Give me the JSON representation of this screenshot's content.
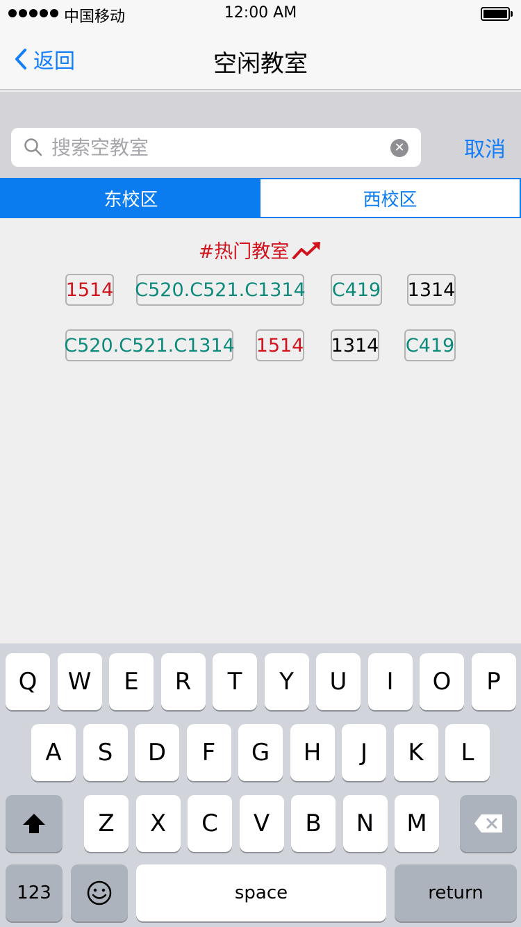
{
  "status_bar": {
    "carrier": "中国移动",
    "time": "12:00 AM"
  },
  "nav": {
    "back_label": "返回",
    "title": "空闲教室"
  },
  "search": {
    "placeholder": "搜索空教室",
    "value": "",
    "cancel_label": "取消"
  },
  "tabs": [
    {
      "label": "东校区",
      "active": true
    },
    {
      "label": "西校区",
      "active": false
    }
  ],
  "hot": {
    "title": "#热门教室",
    "rows": [
      [
        {
          "label": "1514",
          "color": "#d0131d"
        },
        {
          "label": "C520.C521.C1314",
          "color": "#0e8a7b"
        },
        {
          "label": "C419",
          "color": "#0e8a7b"
        },
        {
          "label": "1314",
          "color": "#000000"
        }
      ],
      [
        {
          "label": "C520.C521.C1314",
          "color": "#0e8a7b"
        },
        {
          "label": "1514",
          "color": "#d0131d"
        },
        {
          "label": "1314",
          "color": "#000000"
        },
        {
          "label": "C419",
          "color": "#0e8a7b"
        }
      ]
    ]
  },
  "keyboard": {
    "row1": [
      "Q",
      "W",
      "E",
      "R",
      "T",
      "Y",
      "U",
      "I",
      "O",
      "P"
    ],
    "row2": [
      "A",
      "S",
      "D",
      "F",
      "G",
      "H",
      "J",
      "K",
      "L"
    ],
    "row3": [
      "Z",
      "X",
      "C",
      "V",
      "B",
      "N",
      "M"
    ],
    "numbers_label": "123",
    "space_label": "space",
    "return_label": "return"
  },
  "colors": {
    "accent": "#147efb",
    "tab_active": "#0a7cf0",
    "hot_red": "#d0131d",
    "tag_green": "#0e8a7b"
  }
}
